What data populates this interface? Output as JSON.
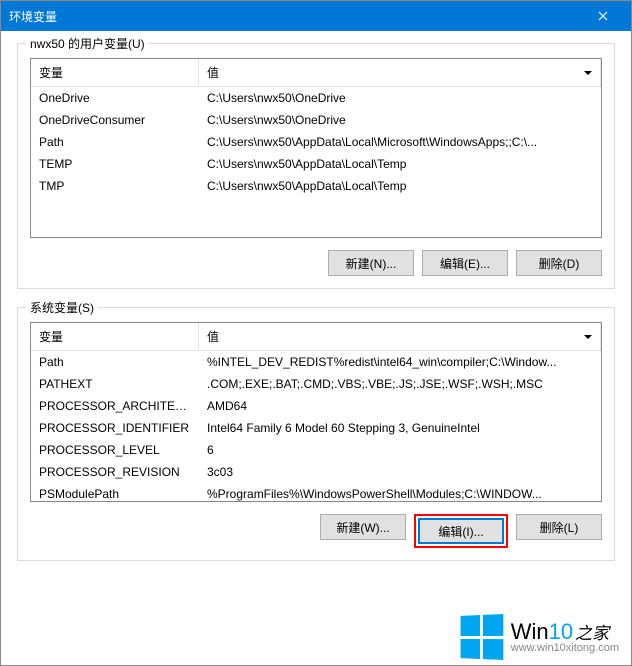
{
  "window": {
    "title": "环境变量"
  },
  "user_section": {
    "label": "nwx50 的用户变量(U)",
    "headers": {
      "var": "变量",
      "val": "值"
    },
    "rows": [
      {
        "var": "OneDrive",
        "val": "C:\\Users\\nwx50\\OneDrive"
      },
      {
        "var": "OneDriveConsumer",
        "val": "C:\\Users\\nwx50\\OneDrive"
      },
      {
        "var": "Path",
        "val": "C:\\Users\\nwx50\\AppData\\Local\\Microsoft\\WindowsApps;;C:\\..."
      },
      {
        "var": "TEMP",
        "val": "C:\\Users\\nwx50\\AppData\\Local\\Temp"
      },
      {
        "var": "TMP",
        "val": "C:\\Users\\nwx50\\AppData\\Local\\Temp"
      }
    ],
    "buttons": {
      "new": "新建(N)...",
      "edit": "编辑(E)...",
      "delete": "删除(D)"
    }
  },
  "system_section": {
    "label": "系统变量(S)",
    "headers": {
      "var": "变量",
      "val": "值"
    },
    "rows": [
      {
        "var": "Path",
        "val": "%INTEL_DEV_REDIST%redist\\intel64_win\\compiler;C:\\Window..."
      },
      {
        "var": "PATHEXT",
        "val": ".COM;.EXE;.BAT;.CMD;.VBS;.VBE;.JS;.JSE;.WSF;.WSH;.MSC"
      },
      {
        "var": "PROCESSOR_ARCHITECT...",
        "val": "AMD64"
      },
      {
        "var": "PROCESSOR_IDENTIFIER",
        "val": "Intel64 Family 6 Model 60 Stepping 3, GenuineIntel"
      },
      {
        "var": "PROCESSOR_LEVEL",
        "val": "6"
      },
      {
        "var": "PROCESSOR_REVISION",
        "val": "3c03"
      },
      {
        "var": "PSModulePath",
        "val": "%ProgramFiles%\\WindowsPowerShell\\Modules;C:\\WINDOW..."
      }
    ],
    "buttons": {
      "new": "新建(W)...",
      "edit": "编辑(I)...",
      "delete": "删除(L)"
    }
  },
  "watermark": {
    "text_win": "Win",
    "text_10": "10",
    "text_zj": "之家",
    "url": "www.win10xitong.com"
  }
}
